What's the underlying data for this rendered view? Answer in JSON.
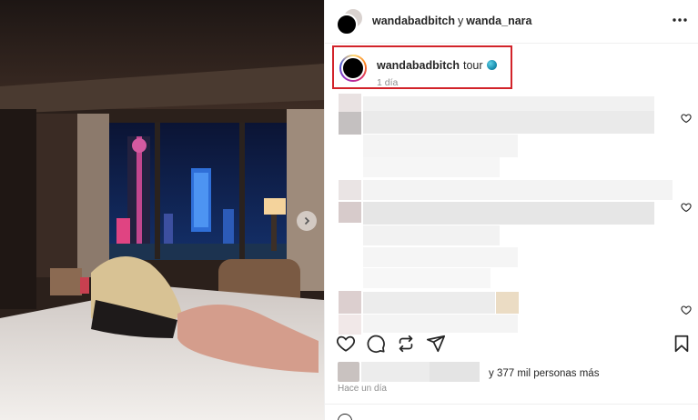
{
  "post": {
    "header": {
      "author1": "wandabadbitch",
      "separator": "y",
      "author2": "wanda_nara",
      "more_icon": "more-horizontal-icon"
    },
    "caption": {
      "username": "wandabadbitch",
      "text": "tour",
      "time": "1 día",
      "globe_icon": "globe-emoji-icon"
    },
    "likes": {
      "count_text": "y 377 mil personas más"
    },
    "timestamp": "Hace un día"
  },
  "colors": {
    "highlight_border": "#d2232a",
    "secondary_text": "#8e8e8e",
    "primary_text": "#262626"
  }
}
